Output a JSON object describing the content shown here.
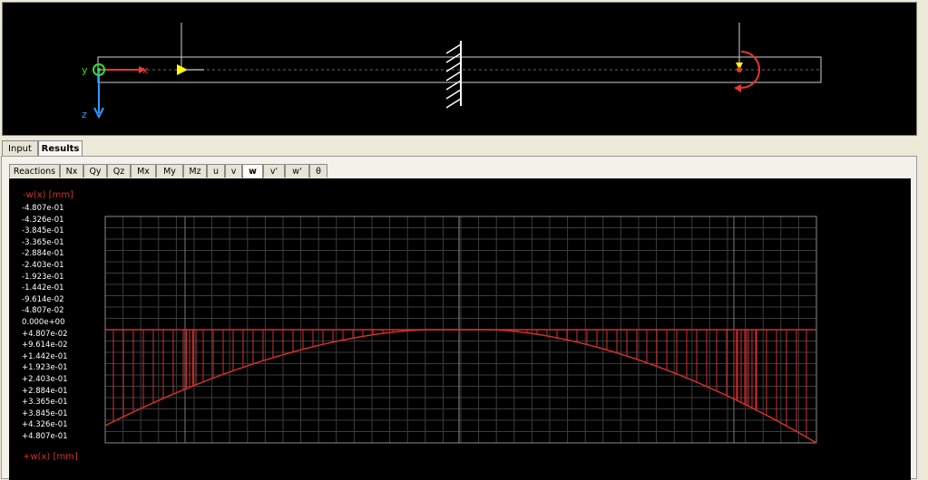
{
  "beam_view": {
    "axis_y": "y",
    "axis_x": "x",
    "axis_z": "z",
    "colors": {
      "support": "#ffffff",
      "load": "#ffff00",
      "moment": "#d32f2f",
      "y_axis": "#33dd33",
      "z_axis": "#3399ff"
    }
  },
  "tabs": {
    "input": "Input",
    "results": "Results"
  },
  "result_tabs": [
    "Reactions",
    "Nx",
    "Qy",
    "Qz",
    "Mx",
    "My",
    "Mz",
    "u",
    "v",
    "w",
    "v'",
    "w'",
    "θ"
  ],
  "active_result_tab": "w",
  "plot": {
    "top_label": "-w(x)  [mm]",
    "bottom_label": "+w(x)  [mm]",
    "tick_labels": [
      "-4.807e-01",
      "-4.326e-01",
      "-3.845e-01",
      "-3.365e-01",
      "-2.884e-01",
      "-2.403e-01",
      "-1.923e-01",
      "-1.442e-01",
      "-9.614e-02",
      "-4.807e-02",
      "0.000e+00",
      "+4.807e-02",
      "+9.614e-02",
      "+1.442e-01",
      "+1.923e-01",
      "+2.403e-01",
      "+2.884e-01",
      "+3.365e-01",
      "+3.845e-01",
      "+4.326e-01",
      "+4.807e-01"
    ],
    "curve_color": "#d32f2f"
  }
}
